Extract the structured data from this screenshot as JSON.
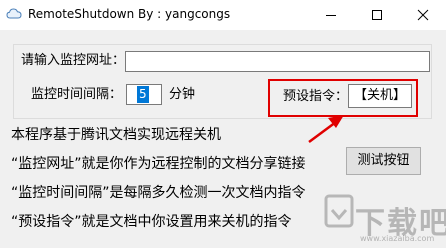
{
  "window": {
    "title": "RemoteShutdown   By : yangcongs"
  },
  "form": {
    "url_label": "请输入监控网址：",
    "url_value": "",
    "interval_label": "监控时间间隔：",
    "interval_value": "5",
    "minute_label": "分钟",
    "preset_label": "预设指令：",
    "preset_value": "【关机】"
  },
  "description": [
    "本程序基于腾讯文档实现远程关机",
    "“监控网址”就是你作为远程控制的文档分享链接",
    "“监控时间间隔”是每隔多久检测一次文档内指令",
    "“预设指令”就是文档中你设置用来关机的指令"
  ],
  "buttons": {
    "test_label": "测试按钮"
  },
  "watermark": {
    "text": "下载吧",
    "sub": "www.xiazaiba.com"
  },
  "colors": {
    "highlight_border": "#e00000",
    "arrow": "#e00000",
    "selection": "#0078d7"
  }
}
